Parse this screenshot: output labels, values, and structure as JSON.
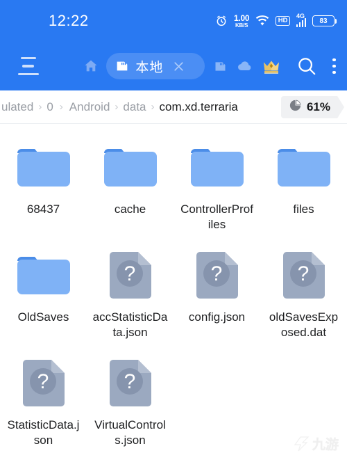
{
  "statusbar": {
    "time": "12:22",
    "alarm_icon": "alarm-icon",
    "net_speed_value": "1.00",
    "net_speed_unit": "KB/S",
    "wifi_icon": "wifi-icon",
    "hd_label": "HD",
    "network_type": "4G",
    "battery_percent": "83"
  },
  "toolbar": {
    "menu_icon": "hamburger-menu-icon",
    "home_icon": "home-icon",
    "tab_label": "本地",
    "tab_icon": "sdcard-icon",
    "tab_close_icon": "close-icon",
    "sdcard_icon": "sdcard-icon",
    "cloud_icon": "cloud-icon",
    "crown_icon": "crown-icon",
    "search_icon": "search-icon",
    "overflow_icon": "more-vertical-icon"
  },
  "breadcrumb": {
    "items": [
      {
        "label": "ulated",
        "current": false
      },
      {
        "label": "0",
        "current": false
      },
      {
        "label": "Android",
        "current": false
      },
      {
        "label": "data",
        "current": false
      },
      {
        "label": "com.xd.terraria",
        "current": true
      }
    ],
    "separator": "›",
    "storage": {
      "icon": "pie-chart-icon",
      "percent": "61%"
    }
  },
  "files": {
    "items": [
      {
        "name": "68437",
        "type": "folder"
      },
      {
        "name": "cache",
        "type": "folder"
      },
      {
        "name": "ControllerProfiles",
        "type": "folder"
      },
      {
        "name": "files",
        "type": "folder"
      },
      {
        "name": "OldSaves",
        "type": "folder"
      },
      {
        "name": "accStatisticData.json",
        "type": "unknown-file"
      },
      {
        "name": "config.json",
        "type": "unknown-file"
      },
      {
        "name": "oldSavesExposed.dat",
        "type": "unknown-file"
      },
      {
        "name": "StatisticData.json",
        "type": "unknown-file"
      },
      {
        "name": "VirtualControls.json",
        "type": "unknown-file"
      }
    ]
  },
  "watermark": {
    "text": "九游"
  },
  "colors": {
    "toolbar_blue": "#2979F2",
    "folder_body": "#7FB2F6",
    "folder_tab": "#4B8DE8",
    "file_body": "#9BA9C0",
    "file_circle": "#8694AD",
    "crown_gold": "#E8C46A"
  }
}
